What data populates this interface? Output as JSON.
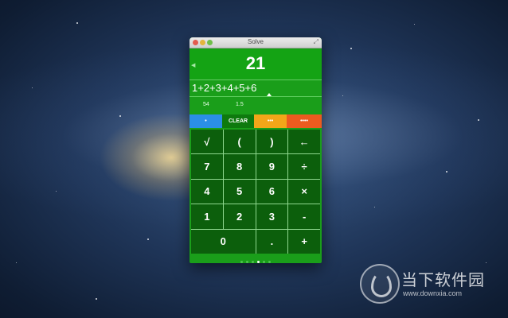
{
  "window": {
    "title": "Solve"
  },
  "display": {
    "result": "21",
    "expression": "1+2+3+4+5+6",
    "hints": [
      "54",
      "1.5"
    ]
  },
  "modes": [
    {
      "label": "•",
      "color": "#2b8fe6"
    },
    {
      "label": "CLEAR",
      "color": "#0e7a0e"
    },
    {
      "label": "•••",
      "color": "#f2a619"
    },
    {
      "label": "••••",
      "color": "#ec5b1f"
    }
  ],
  "keys": {
    "sqrt": "√",
    "lparen": "(",
    "rparen": ")",
    "back": "←",
    "k7": "7",
    "k8": "8",
    "k9": "9",
    "div": "÷",
    "k4": "4",
    "k5": "5",
    "k6": "6",
    "mul": "×",
    "k1": "1",
    "k2": "2",
    "k3": "3",
    "sub": "-",
    "k0": "0",
    "dot": ".",
    "add": "+"
  },
  "pager": {
    "count": 6,
    "active_index": 3
  },
  "watermark": {
    "name": "当下软件园",
    "url": "www.downxia.com"
  },
  "colors": {
    "accent": "#1a9e1a",
    "key_bg": "#0c5f0c"
  }
}
